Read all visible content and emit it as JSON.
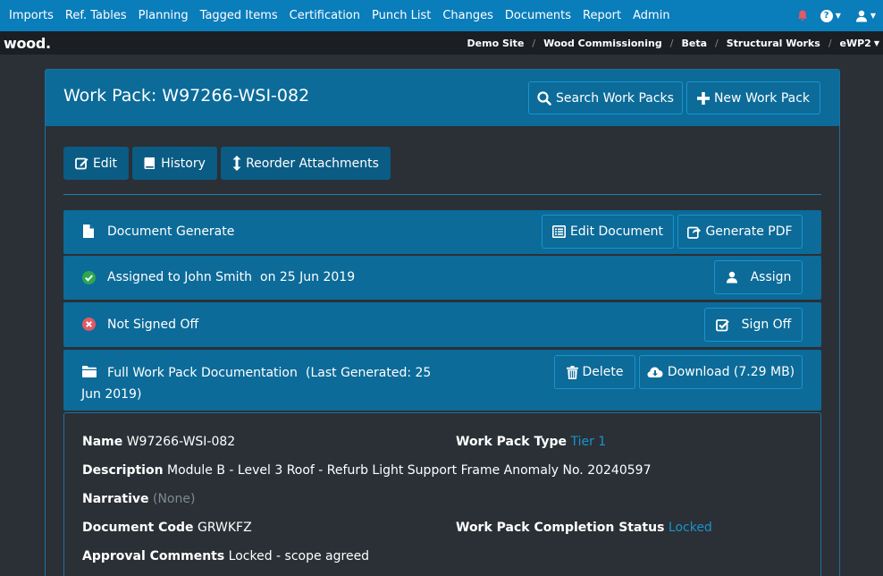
{
  "nav": {
    "items": [
      "Imports",
      "Ref. Tables",
      "Planning",
      "Tagged Items",
      "Certification",
      "Punch List",
      "Changes",
      "Documents",
      "Report",
      "Admin"
    ]
  },
  "brand": {
    "logo": "wood",
    "logo_dot": "."
  },
  "breadcrumb": [
    "Demo Site",
    "Wood Commissioning",
    "Beta",
    "Structural Works",
    "eWP2"
  ],
  "page": {
    "title": "Work Pack: W97266-WSI-082",
    "search_label": "Search Work Packs",
    "new_label": "New Work Pack"
  },
  "toolbar": {
    "edit_label": "Edit",
    "history_label": "History",
    "reorder_label": "Reorder Attachments"
  },
  "rows": {
    "document": {
      "label": "Document Generate",
      "edit_doc": "Edit Document",
      "gen_pdf": "Generate PDF"
    },
    "assigned": {
      "label": "Assigned to John Smith",
      "date": "on 25 Jun 2019",
      "button": "Assign"
    },
    "signoff": {
      "label": "Not Signed Off",
      "button": "Sign Off"
    },
    "full": {
      "label": "Full Work Pack Documentation",
      "generated_line1": "(Last Generated: 25",
      "generated_line2": "Jun 2019)",
      "delete": "Delete",
      "download": "Download (7.29 MB)"
    }
  },
  "details": {
    "name_label": "Name",
    "name_value": "W97266-WSI-082",
    "type_label": "Work Pack Type",
    "type_value": "Tier 1",
    "desc_label": "Description",
    "desc_value": "Module B - Level 3 Roof - Refurb Light Support Frame Anomaly No. 20240597",
    "narr_label": "Narrative",
    "narr_value": "(None)",
    "code_label": "Document Code",
    "code_value": "GRWKFZ",
    "status_label": "Work Pack Completion Status",
    "status_value": "Locked",
    "approval_label": "Approval Comments",
    "approval_value": "Locked - scope agreed"
  },
  "colors": {
    "nav_bg": "#0a7dbb",
    "panel_blue": "#0c6b99",
    "page_bg": "#2a3036",
    "link": "#1a93cf",
    "success": "#2ea84f",
    "danger": "#e05a67"
  }
}
